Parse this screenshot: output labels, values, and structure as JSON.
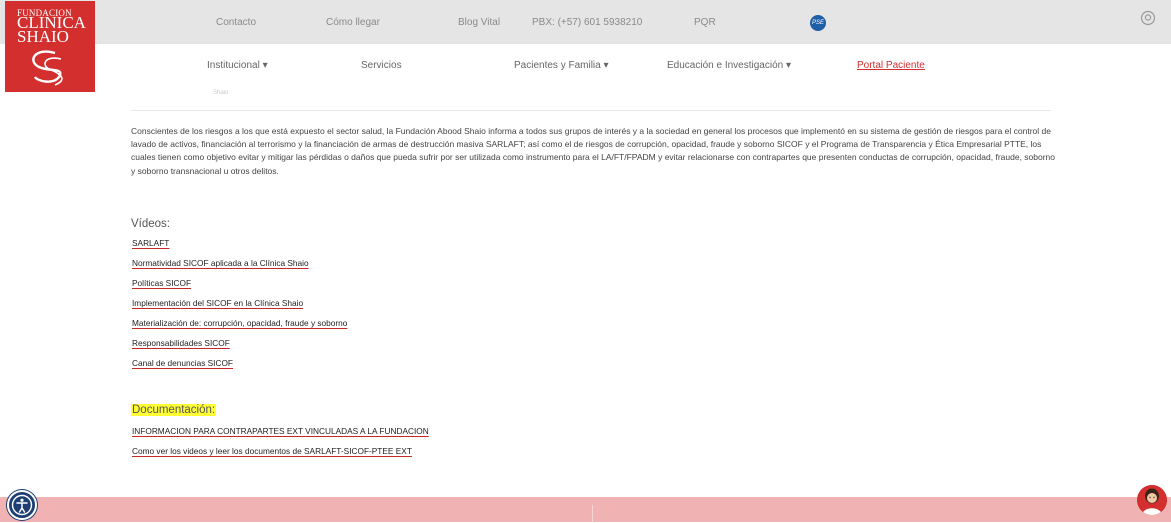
{
  "logo": {
    "line1": "FUNDACION",
    "line2": "CLINICA",
    "line3": "SHAIO"
  },
  "topbar": {
    "links": [
      {
        "label": "Contacto"
      },
      {
        "label": "Cómo llegar"
      },
      {
        "label": "Blog Vital"
      },
      {
        "label": "PBX: (+57) 601 5938210"
      },
      {
        "label": "PQR"
      }
    ],
    "badge_label": "PSE"
  },
  "nav": {
    "items": [
      {
        "label": "Institucional ▾"
      },
      {
        "label": "Servicios"
      },
      {
        "label": "Pacientes y Familia ▾"
      },
      {
        "label": "Educación e Investigación ▾"
      },
      {
        "label": "Portal Paciente"
      }
    ]
  },
  "content": {
    "ghost_text": "Shaio",
    "intro": "Conscientes de los riesgos a los que está expuesto el sector salud, la Fundación Abood Shaio informa a todos sus grupos de interés y a la sociedad en general los procesos que implementó en su sistema de gestión de riesgos para el control de lavado de activos, financiación al terrorismo y la financiación de armas de destrucción masiva SARLAFT; así como el de riesgos de corrupción, opacidad, fraude y soborno SICOF y el Programa de Transparencia y Ética Empresarial PTTE, los cuales tienen como objetivo evitar y mitigar las pérdidas o daños que pueda sufrir por ser utilizada como instrumento para el LA/FT/FPADM y evitar relacionarse con contrapartes que presenten conductas de corrupción, opacidad, fraude, soborno y soborno transnacional u otros delitos.",
    "videos_heading": "Vídeos:",
    "videos": [
      {
        "label": "SARLAFT"
      },
      {
        "label": "Normatividad SICOF aplicada a la Clínica Shaio"
      },
      {
        "label": "Políticas SICOF"
      },
      {
        "label": "Implementación del SICOF en la Clínica Shaio"
      },
      {
        "label": "Materialización de: corrupción, opacidad, fraude y soborno"
      },
      {
        "label": "Responsabilidades SICOF"
      },
      {
        "label": "Canal de denuncias SICOF"
      }
    ],
    "docs_heading": "Documentación:",
    "docs": [
      {
        "label": "INFORMACION PARA CONTRAPARTES EXT VINCULADAS A LA FUNDACION"
      },
      {
        "label": "Como ver  los videos y leer los documentos de SARLAFT-SICOF-PTEE EXT"
      }
    ]
  },
  "colors": {
    "brand_red": "#d32f2f",
    "topbar_bg": "#e5e5e5",
    "footer_bg": "#f0b2b2",
    "highlight": "#ffff33",
    "accessibility_blue": "#1e3f73"
  },
  "icons": {
    "user": "user-circle-icon",
    "accessibility": "accessibility-icon",
    "chat": "chat-assistant-icon"
  }
}
